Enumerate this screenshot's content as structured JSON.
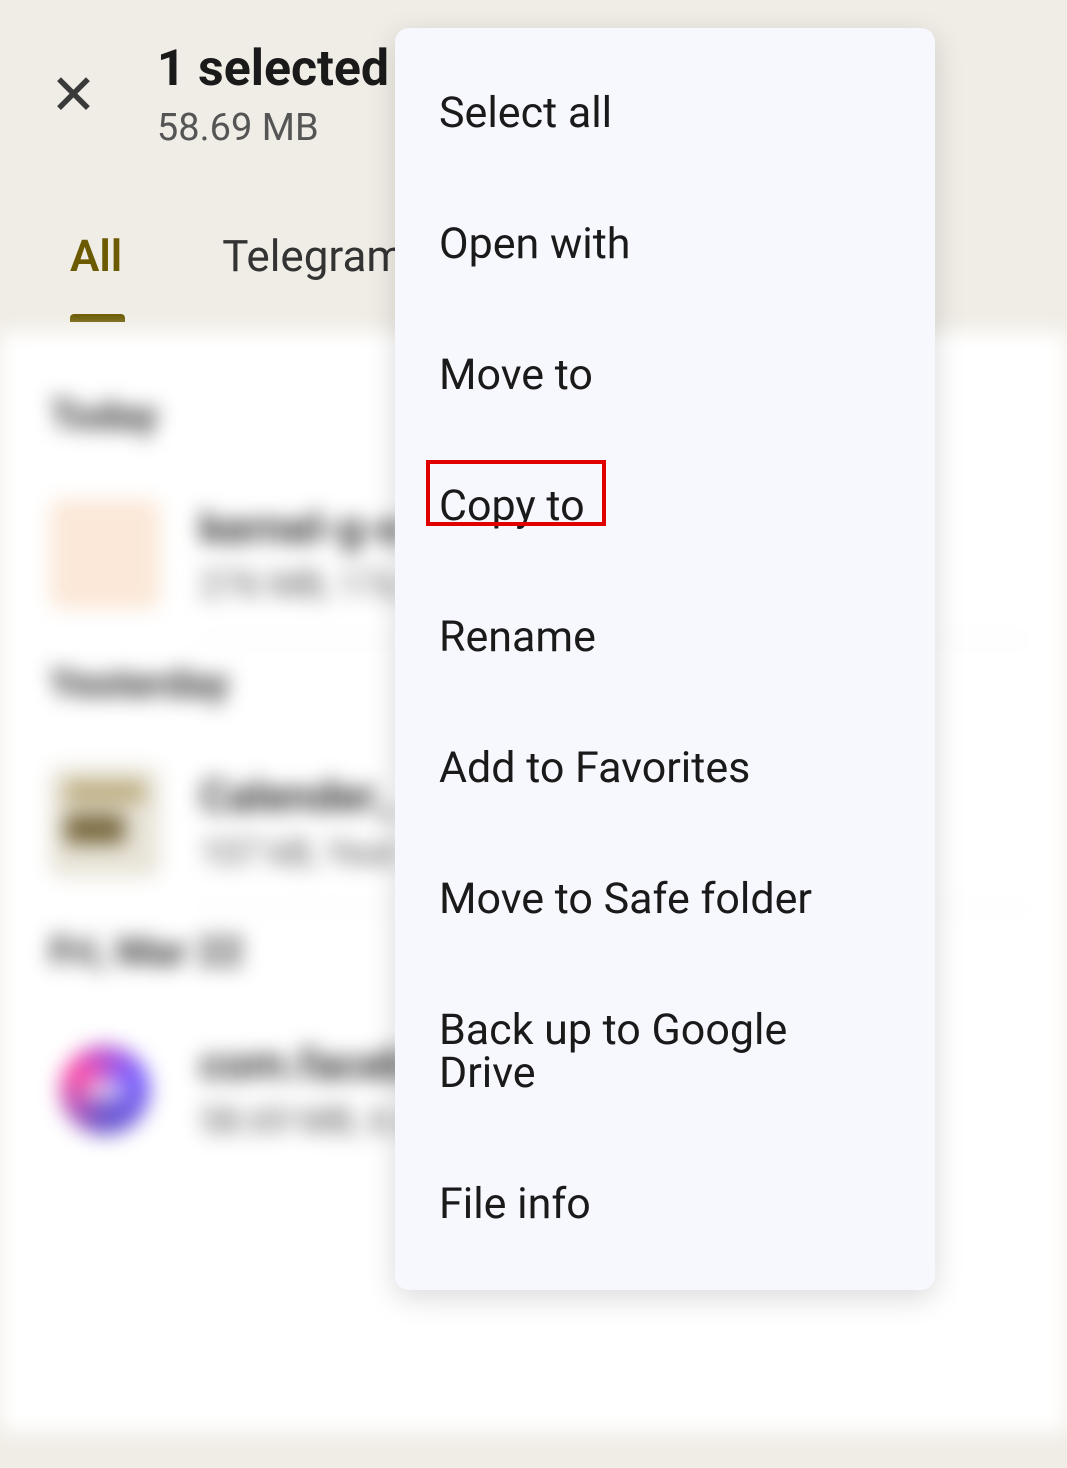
{
  "header": {
    "title": "1 selected",
    "subtitle": "58.69 MB"
  },
  "tabs": [
    {
      "label": "All",
      "active": true
    },
    {
      "label": "Telegram",
      "active": false
    }
  ],
  "sections": [
    {
      "label": "Today"
    },
    {
      "label": "Yesterday"
    },
    {
      "label": "Fri, Mar 22"
    }
  ],
  "menu": {
    "items": [
      "Select all",
      "Open with",
      "Move to",
      "Copy to",
      "Rename",
      "Add to Favorites",
      "Move to Safe folder",
      "Back up to Google Drive",
      "File info"
    ],
    "highlighted_index": 3
  }
}
